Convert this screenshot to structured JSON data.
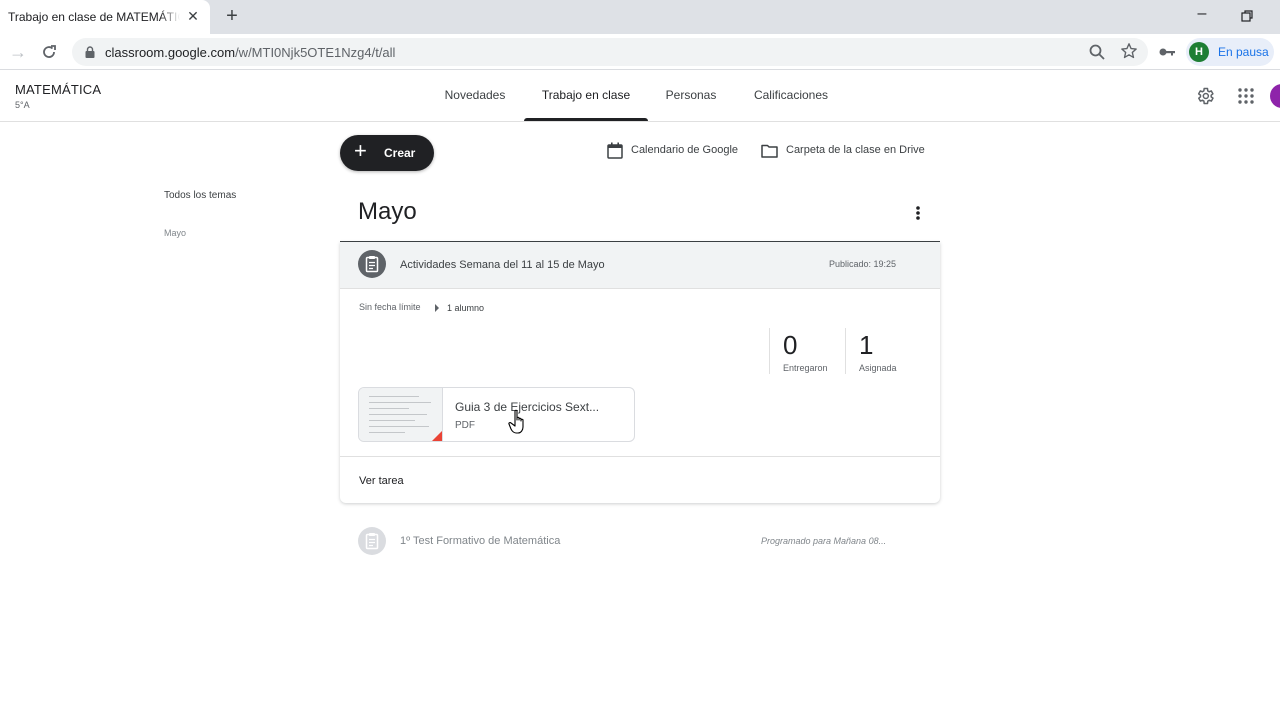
{
  "browser": {
    "tab_title": "Trabajo en clase de MATEMÁTICA",
    "url_host": "classroom.google.com",
    "url_path": "/w/MTI0Njk5OTE1Nzg4/t/all",
    "profile_initial": "H",
    "profile_status": "En pausa"
  },
  "header": {
    "class_name": "MATEMÁTICA",
    "class_section": "5°A",
    "tabs": [
      {
        "label": "Novedades",
        "active": false
      },
      {
        "label": "Trabajo en clase",
        "active": true
      },
      {
        "label": "Personas",
        "active": false
      },
      {
        "label": "Calificaciones",
        "active": false
      }
    ]
  },
  "sidebar": {
    "all_topics": "Todos los temas",
    "topics": [
      "Mayo"
    ]
  },
  "toolbar": {
    "create_label": "Crear",
    "calendar_label": "Calendario de Google",
    "drive_label": "Carpeta de la clase en Drive"
  },
  "topic": {
    "title": "Mayo",
    "assignment": {
      "title": "Actividades Semana del 11 al 15 de Mayo",
      "published": "Publicado: 19:25",
      "due": "Sin fecha límite",
      "assigned_to": "1 alumno",
      "turned_in_count": "0",
      "turned_in_label": "Entregaron",
      "assigned_count": "1",
      "assigned_label": "Asignada",
      "attachment": {
        "title": "Guia 3 de Ejercicios Sext...",
        "type": "PDF"
      },
      "view_label": "Ver tarea"
    },
    "scheduled": {
      "title": "1º Test Formativo de Matemática",
      "status": "Programado para Mañana 08..."
    }
  },
  "colors": {
    "accent_dark": "#202124",
    "profile_green": "#1e7e34",
    "pdf_red": "#ea4335",
    "avatar_purple": "#8e24aa"
  }
}
